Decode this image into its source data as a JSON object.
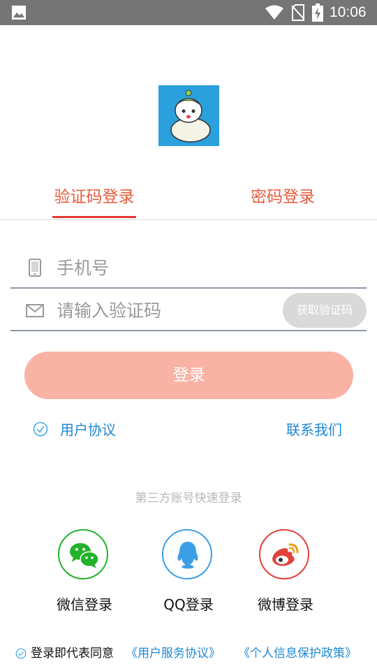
{
  "status_bar": {
    "time": "10:06",
    "icons": [
      "gallery-icon",
      "wifi-icon",
      "no-sim-icon",
      "battery-charging-icon"
    ]
  },
  "logo": {
    "icon": "app-logo-mascot"
  },
  "tabs": [
    {
      "label": "验证码登录",
      "active": true
    },
    {
      "label": "密码登录",
      "active": false
    }
  ],
  "form": {
    "phone": {
      "placeholder": "手机号",
      "value": "",
      "icon": "phone-icon"
    },
    "code": {
      "placeholder": "请输入验证码",
      "value": "",
      "icon": "mail-icon"
    },
    "get_code_label": "获取验证码",
    "login_label": "登录"
  },
  "agreement": {
    "label": "用户协议",
    "icon": "check-circle-icon"
  },
  "contact": {
    "label": "联系我们"
  },
  "third_party": {
    "title": "第三方账号快速登录",
    "items": [
      {
        "label": "微信登录",
        "icon": "wechat-icon"
      },
      {
        "label": "QQ登录",
        "icon": "qq-icon"
      },
      {
        "label": "微博登录",
        "icon": "weibo-icon"
      }
    ]
  },
  "footer": {
    "text": "登录即代表同意",
    "service_link": "《用户服务协议》",
    "privacy_link": "《个人信息保护政策》"
  },
  "colors": {
    "accent": "#ea5a3c",
    "link": "#1e88d6",
    "login_button": "#f8b3a5",
    "wechat": "#22b32a",
    "qq": "#3c9fe6",
    "weibo": "#e0413a"
  }
}
